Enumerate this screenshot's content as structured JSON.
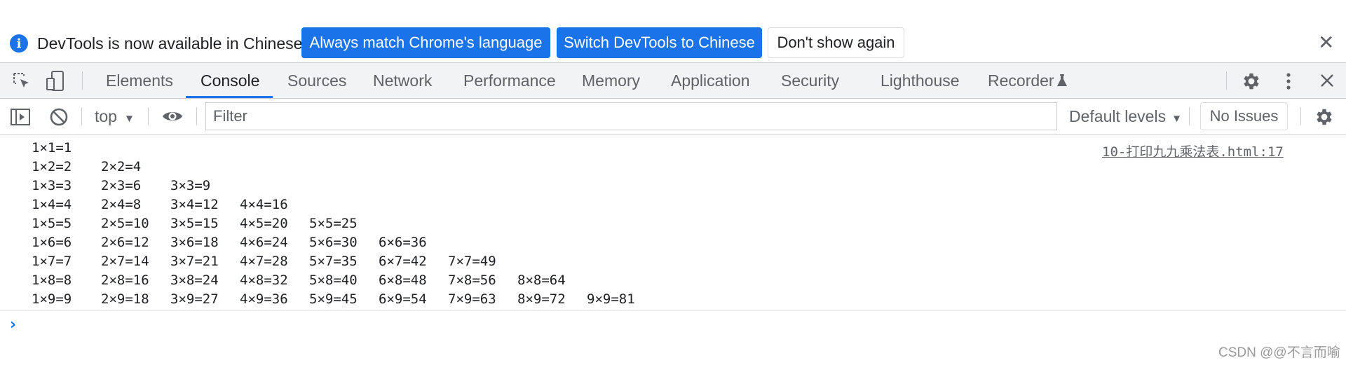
{
  "infobar": {
    "message": "DevTools is now available in Chinese!",
    "buttons": [
      "Always match Chrome's language",
      "Switch DevTools to Chinese",
      "Don't show again"
    ],
    "close_glyph": "✕",
    "info_glyph": "i"
  },
  "tabs": [
    "Elements",
    "Console",
    "Sources",
    "Network",
    "Performance",
    "Memory",
    "Application",
    "Security",
    "Lighthouse",
    "Recorder"
  ],
  "active_tab": "Console",
  "toolbar": {
    "context": "top",
    "filter_placeholder": "Filter",
    "levels": "Default levels",
    "issues": "No Issues"
  },
  "console": {
    "source_link": "10-打印九九乘法表.html:17",
    "rows": [
      [
        "1×1=1"
      ],
      [
        "1×2=2",
        "2×2=4"
      ],
      [
        "1×3=3",
        "2×3=6",
        "3×3=9"
      ],
      [
        "1×4=4",
        "2×4=8",
        "3×4=12",
        "4×4=16"
      ],
      [
        "1×5=5",
        "2×5=10",
        "3×5=15",
        "4×5=20",
        "5×5=25"
      ],
      [
        "1×6=6",
        "2×6=12",
        "3×6=18",
        "4×6=24",
        "5×6=30",
        "6×6=36"
      ],
      [
        "1×7=7",
        "2×7=14",
        "3×7=21",
        "4×7=28",
        "5×7=35",
        "6×7=42",
        "7×7=49"
      ],
      [
        "1×8=8",
        "2×8=16",
        "3×8=24",
        "4×8=32",
        "5×8=40",
        "6×8=48",
        "7×8=56",
        "8×8=64"
      ],
      [
        "1×9=9",
        "2×9=18",
        "3×9=27",
        "4×9=36",
        "5×9=45",
        "6×9=54",
        "7×9=63",
        "8×9=72",
        "9×9=81"
      ]
    ],
    "prompt_glyph": "›"
  },
  "watermark": "CSDN @@不言而喻",
  "colors": {
    "accent": "#1a73e8",
    "toolbar_bg": "#f1f3f4",
    "border": "#cbcdd1"
  }
}
